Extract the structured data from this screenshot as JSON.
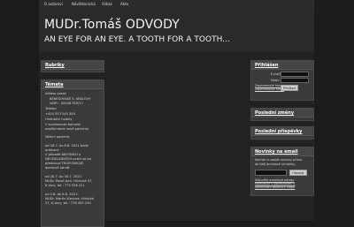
{
  "topnav": [
    "O autorovi",
    "Návštěvnická",
    "Vzkaz",
    "Akte"
  ],
  "header": {
    "title": "MUDr.Tomáš ODVODY",
    "subtitle": "AN EYE FOR AN EYE. A TOOTH FOR A TOOTH..."
  },
  "left": {
    "rubriky_title": "Rubriky",
    "temata_title": "Témata",
    "lines": [
      "Adresa praxe",
      "BENEŠOVSKÉ 3, KRALOVY",
      "VARY - DOLNÍ 359/17",
      "Telefon",
      "+420 353 545 355",
      "Ordinační hodiny",
      "V současnosti bohužel",
      "nepřijímáme nové pacienty",
      "",
      "Vážení pacienti,",
      "",
      "od 28.7. do 6.8. 2021 bude",
      "ordinace",
      "V případě AKUTNÍCH a",
      "NEODKLADNÝCH potíží se po",
      "předchozí TELEFONICKÉ",
      "domluvě obraťt",
      "",
      "od 28.7. do 30.7. 2021:",
      "MUDr. Pavel Jech, Hlinická 37,",
      "K.Vary, tel.: 775 558 221",
      "",
      "od 2.8. do 6.8. 2021:",
      "MUDr. Martin Klechek, Hlinická",
      "37, K.Vary, tel.: 776 445 230"
    ]
  },
  "right": {
    "login": {
      "title": "Přihlášen",
      "email_label": "E-mail",
      "password_label": "Heslo",
      "forgot_label": "Zapomenuté heslo",
      "remember_label": "Zapamatovat heslo",
      "submit_label": "Přihlásit"
    },
    "posledni_zmeny": "Poslední změny",
    "posledni_prispevky": "Poslední příspěvky",
    "newsletter": {
      "title": "Novinky na email",
      "text1": "Nechte si zasílat novinky přímo",
      "text2": "do Vaší emailové schránky.",
      "submit_label": "Odeslat",
      "footer1": "Stáhněte emailové adresy",
      "footer2": "souhlasíte s podmínkami o",
      "footer3": "zpracování osobních údajů"
    }
  }
}
